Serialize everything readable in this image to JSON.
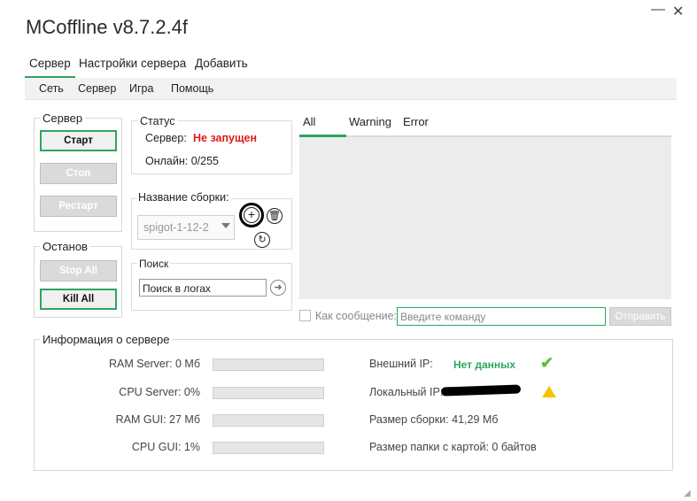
{
  "app": {
    "title": "MCoffline v8.7.2.4f"
  },
  "tabs": [
    "Сервер",
    "Настройки сервера",
    "Добавить"
  ],
  "menu": [
    "Сеть",
    "Сервер",
    "Игра",
    "Помощь"
  ],
  "server_group": {
    "label": "Сервер",
    "start": "Старт",
    "stop": "Стоп",
    "restart": "Рестарт"
  },
  "stop_group": {
    "label": "Останов",
    "stop_all": "Stop All",
    "kill_all": "Kill All"
  },
  "status": {
    "label": "Статус",
    "server_label": "Сервер:",
    "server_value": "Не запущен",
    "online_label": "Онлайн: 0/255"
  },
  "build": {
    "label": "Название сборки:",
    "selected": "spigot-1-12-2"
  },
  "search": {
    "label": "Поиск",
    "placeholder": "Поиск в логах"
  },
  "logs": {
    "tabs": [
      "All",
      "Warning",
      "Error"
    ]
  },
  "command": {
    "as_message": "Как сообщение:",
    "placeholder": "Введите команду",
    "send": "Отправить"
  },
  "info": {
    "label": "Информация о сервере",
    "ram_server": "RAM Server: 0 Мб",
    "cpu_server": "CPU Server: 0%",
    "ram_gui": "RAM GUI: 27 Мб",
    "cpu_gui": "CPU GUI: 1%",
    "external_ip_label": "Внешний IP:",
    "external_ip_value": "Нет данных",
    "local_ip_label": "Локальный IP:",
    "build_size": "Размер сборки: 41,29 Мб",
    "map_size": "Размер папки с картой: 0 байтов"
  },
  "colors": {
    "accent": "#2ea55f",
    "status_error": "#e01b1b"
  }
}
